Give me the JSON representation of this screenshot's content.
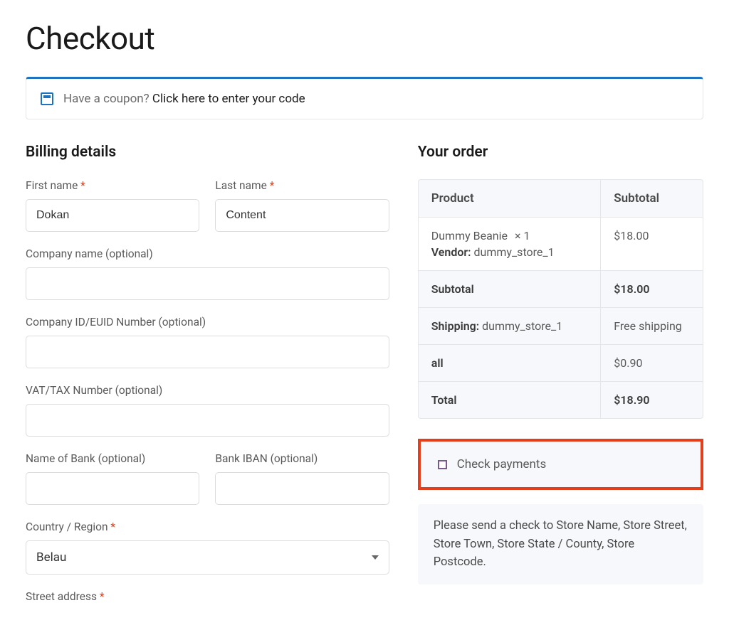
{
  "page": {
    "title": "Checkout"
  },
  "coupon": {
    "prompt": "Have a coupon? ",
    "link_text": "Click here to enter your code"
  },
  "billing": {
    "heading": "Billing details",
    "first_name": {
      "label": "First name",
      "required": true,
      "value": "Dokan"
    },
    "last_name": {
      "label": "Last name",
      "required": true,
      "value": "Content"
    },
    "company_name": {
      "label": "Company name (optional)",
      "required": false,
      "value": ""
    },
    "company_id": {
      "label": "Company ID/EUID Number (optional)",
      "required": false,
      "value": ""
    },
    "vat_tax": {
      "label": "VAT/TAX Number (optional)",
      "required": false,
      "value": ""
    },
    "bank_name": {
      "label": "Name of Bank (optional)",
      "required": false,
      "value": ""
    },
    "bank_iban": {
      "label": "Bank IBAN (optional)",
      "required": false,
      "value": ""
    },
    "country": {
      "label": "Country / Region",
      "required": true,
      "value": "Belau"
    },
    "street": {
      "label": "Street address",
      "required": true
    }
  },
  "order": {
    "heading": "Your order",
    "header_product": "Product",
    "header_subtotal": "Subtotal",
    "item_name": "Dummy Beanie",
    "item_qty": "× 1",
    "vendor_label": "Vendor:",
    "vendor_name": "dummy_store_1",
    "item_subtotal": "$18.00",
    "subtotal_label": "Subtotal",
    "subtotal_value": "$18.00",
    "shipping_label": "Shipping:",
    "shipping_vendor": "dummy_store_1",
    "shipping_value": "Free shipping",
    "all_label": "all",
    "all_value": "$0.90",
    "total_label": "Total",
    "total_value": "$18.90"
  },
  "payment": {
    "method_label": "Check payments",
    "description": "Please send a check to Store Name, Store Street, Store Town, Store State / County, Store Postcode."
  }
}
